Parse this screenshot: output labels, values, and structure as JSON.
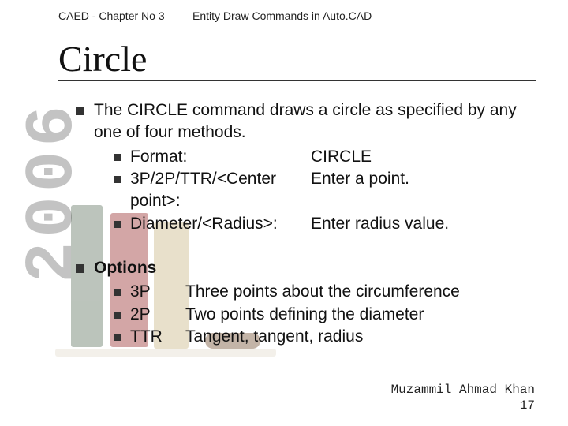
{
  "year": "2006",
  "header": {
    "left": "CAED - Chapter No 3",
    "right": "Entity Draw Commands in Auto.CAD"
  },
  "title": "Circle",
  "section1": {
    "lead": "The CIRCLE command draws a circle as specified by any one of four methods.",
    "rows": [
      {
        "left": "Format:",
        "right": "CIRCLE"
      },
      {
        "left": "3P/2P/TTR/<Center point>:",
        "right": "Enter a point."
      },
      {
        "left": "Diameter/<Radius>:",
        "right": "Enter radius value."
      }
    ]
  },
  "section2": {
    "lead": "Options",
    "rows": [
      {
        "key": "3P",
        "desc": "Three points about the circumference"
      },
      {
        "key": "2P",
        "desc": "Two points defining the diameter"
      },
      {
        "key": "TTR",
        "desc": "Tangent, tangent, radius"
      }
    ]
  },
  "footer": {
    "author": "Muzammil Ahmad Khan",
    "page": "17"
  }
}
